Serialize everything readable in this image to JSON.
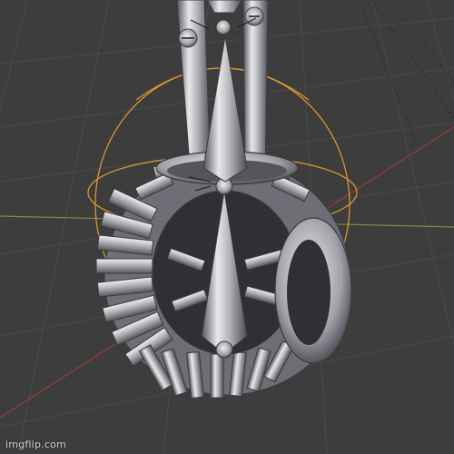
{
  "viewport": {
    "background": "#3d3d3d",
    "grid_color": "#4a4a4a",
    "x_axis_color": "#9b3a3a",
    "y_axis_color": "#7d8f3a",
    "gizmo_color": "#d9962f",
    "metal_light": "#e6e6ea",
    "metal_mid": "#a9a9b0",
    "metal_dark": "#4a4a52"
  },
  "watermark": {
    "text": "imgflip.com"
  }
}
